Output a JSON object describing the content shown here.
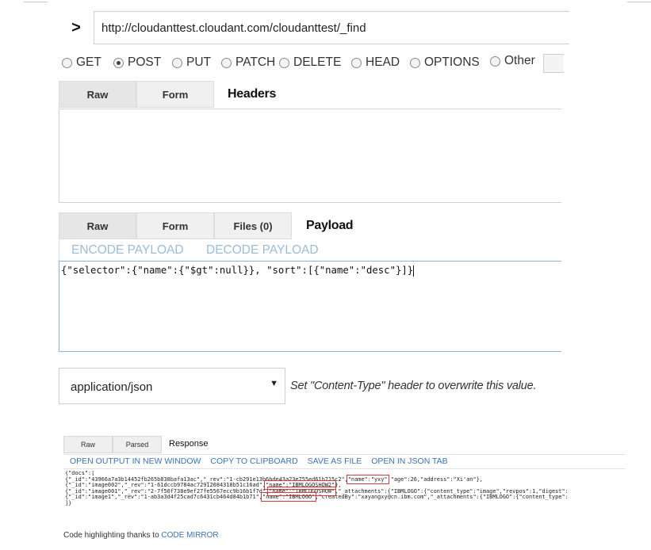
{
  "url_bar": {
    "value": "http://cloudanttest.cloudant.com/cloudanttest/_find",
    "go_glyph": ">"
  },
  "methods": [
    {
      "label": "GET",
      "checked": false
    },
    {
      "label": "POST",
      "checked": true
    },
    {
      "label": "PUT",
      "checked": false
    },
    {
      "label": "PATCH",
      "checked": false
    },
    {
      "label": "DELETE",
      "checked": false
    },
    {
      "label": "HEAD",
      "checked": false
    },
    {
      "label": "OPTIONS",
      "checked": false
    },
    {
      "label": "Other",
      "checked": false
    }
  ],
  "headers_tabs": {
    "raw": "Raw",
    "form": "Form",
    "title": "Headers"
  },
  "payload_tabs": {
    "raw": "Raw",
    "form": "Form",
    "files": "Files (0)",
    "title": "Payload"
  },
  "payload_actions": {
    "encode": "ENCODE PAYLOAD",
    "decode": "DECODE PAYLOAD"
  },
  "payload_body": "{\"selector\":{\"name\":{\"$gt\":null}}, \"sort\":[{\"name\":\"desc\"}]}",
  "content_type": {
    "value": "application/json",
    "hint": "Set \"Content-Type\" header to overwrite this value."
  },
  "response": {
    "tabs": {
      "raw": "Raw",
      "parsed": "Parsed"
    },
    "title": "Response",
    "links": [
      "OPEN OUTPUT IN NEW WINDOW",
      "COPY TO CLIPBOARD",
      "SAVE AS FILE",
      "OPEN IN JSON TAB"
    ],
    "code": {
      "line1": "{\"docs\":[",
      "line2_a": "{\"_id\":\"43966a7a3b14452fb265b838bafa13ac\",\"_rev\":\"1-cb291e13b6bde43a23e755ed61b715c2\",",
      "line2_hl": "\"name\":\"yxy\"",
      "line2_b": ",\"age\":26,\"address\":\"Xi'an\"},",
      "line3_a": "{\"_id\":\"image002\",\"_rev\":\"1-61dccb9784ac72912084318b51c16ad\",",
      "line3_hl": "\"name\":\"IBMLOGOSHOW2\"",
      "line3_b": "},",
      "line4_a": "{\"_id\":\"image001\",\"_rev\":\"2-7f50f738e9ef27fe5567ecc9b16b1f7d\",",
      "line4_hl": "\"name\":\"IBMLOGOSHOW\"",
      "line4_b": ",\"_attachments\":{\"IBMLOGO\":{\"content_type\":\"image\",\"revpos\":1,\"digest\":",
      "line5_a": "{\"_id\":\"image1\",\"_rev\":\"1-ab3a3d4f25cad7c6431cb464d84b1b71\",",
      "line5_hl": "\"name\":\"IBMLOGO\"",
      "line5_b": ",\"createdBy\":\"xayangxy@cn.ibm.com\",\"_attachments\":{\"IBMLOGO\":{\"content_type\":",
      "line6": "]}"
    },
    "footer_text": "Code highlighting thanks to ",
    "footer_link": "CODE MIRROR"
  }
}
